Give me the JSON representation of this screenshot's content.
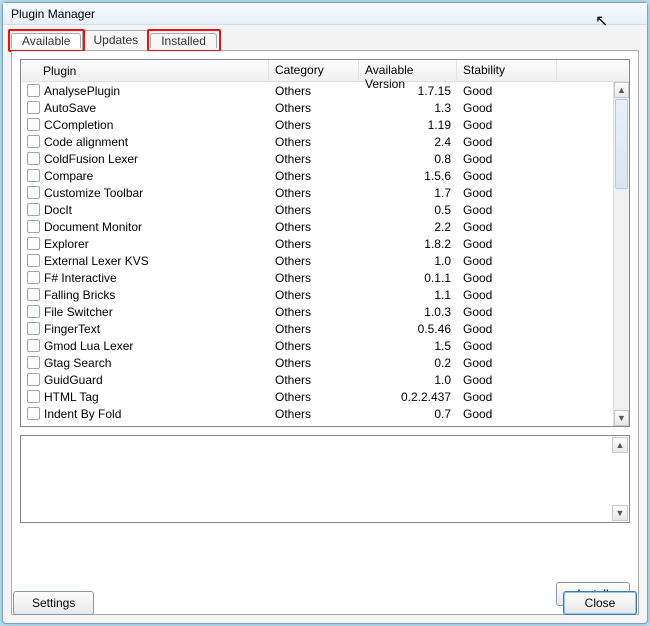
{
  "window": {
    "title": "Plugin Manager"
  },
  "tabs": {
    "available": "Available",
    "updates": "Updates",
    "installed": "Installed"
  },
  "columns": {
    "plugin": "Plugin",
    "category": "Category",
    "version": "Available Version",
    "stability": "Stability"
  },
  "rows": [
    {
      "name": "AnalysePlugin",
      "category": "Others",
      "version": "1.7.15",
      "stability": "Good"
    },
    {
      "name": "AutoSave",
      "category": "Others",
      "version": "1.3",
      "stability": "Good"
    },
    {
      "name": "CCompletion",
      "category": "Others",
      "version": "1.19",
      "stability": "Good"
    },
    {
      "name": "Code alignment",
      "category": "Others",
      "version": "2.4",
      "stability": "Good"
    },
    {
      "name": "ColdFusion Lexer",
      "category": "Others",
      "version": "0.8",
      "stability": "Good"
    },
    {
      "name": "Compare",
      "category": "Others",
      "version": "1.5.6",
      "stability": "Good"
    },
    {
      "name": "Customize Toolbar",
      "category": "Others",
      "version": "1.7",
      "stability": "Good"
    },
    {
      "name": "DocIt",
      "category": "Others",
      "version": "0.5",
      "stability": "Good"
    },
    {
      "name": "Document Monitor",
      "category": "Others",
      "version": "2.2",
      "stability": "Good"
    },
    {
      "name": "Explorer",
      "category": "Others",
      "version": "1.8.2",
      "stability": "Good"
    },
    {
      "name": "External Lexer KVS",
      "category": "Others",
      "version": "1.0",
      "stability": "Good"
    },
    {
      "name": "F# Interactive",
      "category": "Others",
      "version": "0.1.1",
      "stability": "Good"
    },
    {
      "name": "Falling Bricks",
      "category": "Others",
      "version": "1.1",
      "stability": "Good"
    },
    {
      "name": "File Switcher",
      "category": "Others",
      "version": "1.0.3",
      "stability": "Good"
    },
    {
      "name": "FingerText",
      "category": "Others",
      "version": "0.5.46",
      "stability": "Good"
    },
    {
      "name": "Gmod Lua Lexer",
      "category": "Others",
      "version": "1.5",
      "stability": "Good"
    },
    {
      "name": "Gtag Search",
      "category": "Others",
      "version": "0.2",
      "stability": "Good"
    },
    {
      "name": "GuidGuard",
      "category": "Others",
      "version": "1.0",
      "stability": "Good"
    },
    {
      "name": "HTML Tag",
      "category": "Others",
      "version": "0.2.2.437",
      "stability": "Good"
    },
    {
      "name": "Indent By Fold",
      "category": "Others",
      "version": "0.7",
      "stability": "Good"
    }
  ],
  "buttons": {
    "install": "Install",
    "settings": "Settings",
    "close": "Close"
  }
}
